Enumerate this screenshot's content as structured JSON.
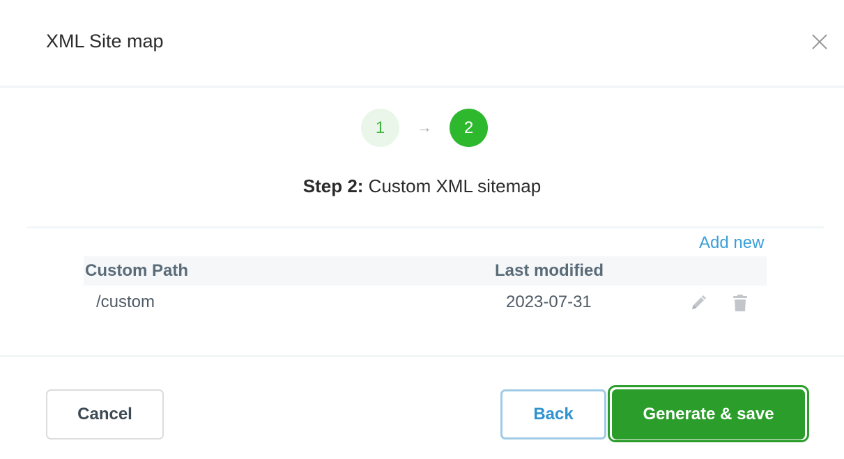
{
  "modal": {
    "title": "XML Site map",
    "close_icon": "close-icon"
  },
  "stepper": {
    "steps": [
      {
        "number": "1",
        "state": "completed"
      },
      {
        "number": "2",
        "state": "active"
      }
    ],
    "arrow_glyph": "→"
  },
  "step_heading": {
    "prefix": "Step 2:",
    "text": " Custom XML sitemap"
  },
  "table": {
    "add_new_label": "Add new",
    "columns": [
      "Custom Path",
      "Last modified"
    ],
    "rows": [
      {
        "path": "/custom",
        "last_modified": "2023-07-31",
        "actions": [
          "pencil-icon",
          "trash-icon"
        ]
      }
    ]
  },
  "footer": {
    "cancel_label": "Cancel",
    "back_label": "Back",
    "generate_label": "Generate & save"
  },
  "colors": {
    "accent_green": "#2a9d2a",
    "active_step": "#2eb82e",
    "link_blue": "#3aa0d8",
    "back_border": "#9fcbe6"
  }
}
